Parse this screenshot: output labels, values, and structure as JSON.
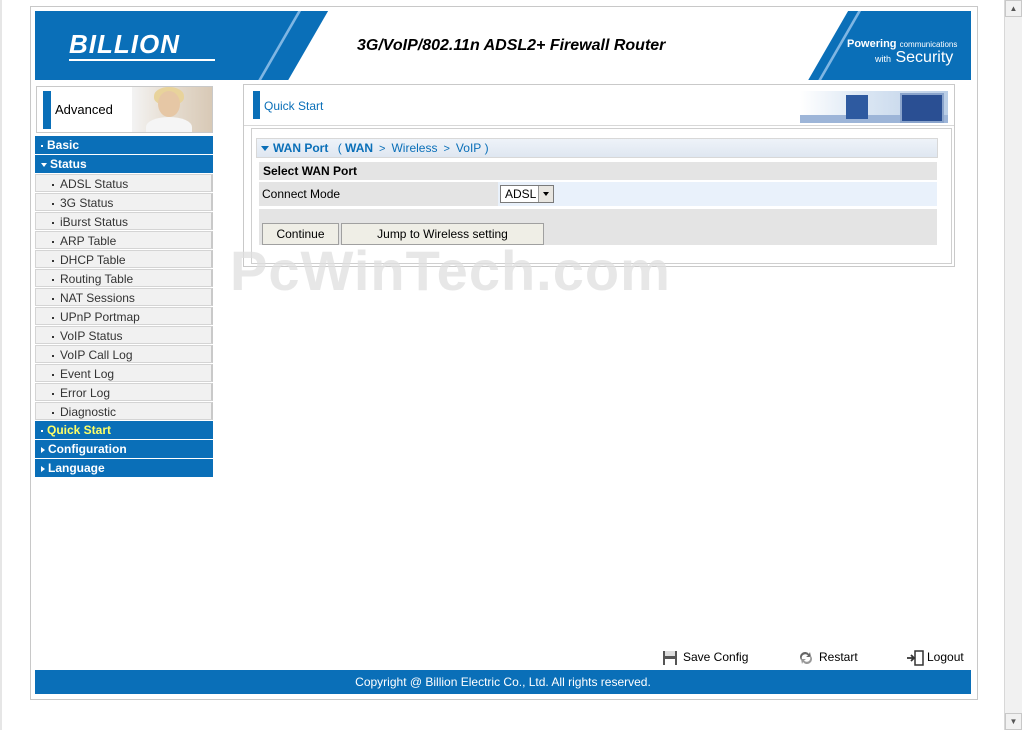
{
  "header": {
    "logo": "BILLION",
    "title": "3G/VoIP/802.11n ADSL2+ Firewall Router",
    "tagline_top": "Powering",
    "tagline_top_small": "communications",
    "tagline_bottom_small": "with",
    "tagline_bottom": "Security"
  },
  "sidebar": {
    "mode_label": "Advanced",
    "items": [
      {
        "label": "Basic",
        "type": "main",
        "icon": "dot"
      },
      {
        "label": "Status",
        "type": "main",
        "icon": "triangle-down"
      },
      {
        "label": "ADSL Status",
        "type": "sub"
      },
      {
        "label": "3G Status",
        "type": "sub"
      },
      {
        "label": "iBurst Status",
        "type": "sub"
      },
      {
        "label": "ARP Table",
        "type": "sub"
      },
      {
        "label": "DHCP Table",
        "type": "sub"
      },
      {
        "label": "Routing Table",
        "type": "sub"
      },
      {
        "label": "NAT Sessions",
        "type": "sub"
      },
      {
        "label": "UPnP Portmap",
        "type": "sub"
      },
      {
        "label": "VoIP Status",
        "type": "sub"
      },
      {
        "label": "VoIP Call Log",
        "type": "sub"
      },
      {
        "label": "Event Log",
        "type": "sub"
      },
      {
        "label": "Error Log",
        "type": "sub"
      },
      {
        "label": "Diagnostic",
        "type": "sub"
      },
      {
        "label": "Quick Start",
        "type": "main",
        "icon": "dot",
        "active": true
      },
      {
        "label": "Configuration",
        "type": "main",
        "icon": "triangle-right"
      },
      {
        "label": "Language",
        "type": "main",
        "icon": "triangle-right"
      }
    ]
  },
  "main": {
    "section_title": "Quick Start",
    "wizard": {
      "current": "WAN Port",
      "steps": [
        "WAN",
        "Wireless",
        "VoIP"
      ],
      "separator": ">"
    },
    "select_heading": "Select WAN Port",
    "connect_mode_label": "Connect Mode",
    "connect_mode_value": "ADSL",
    "continue_label": "Continue",
    "jump_label": "Jump to Wireless setting"
  },
  "watermark": "PcWinTech.com",
  "actions": {
    "save": "Save Config",
    "restart": "Restart",
    "logout": "Logout"
  },
  "footer": "Copyright @ Billion Electric Co., Ltd. All rights reserved.",
  "colors": {
    "brand_blue": "#0a6fb8",
    "active_text": "#ffff66"
  }
}
